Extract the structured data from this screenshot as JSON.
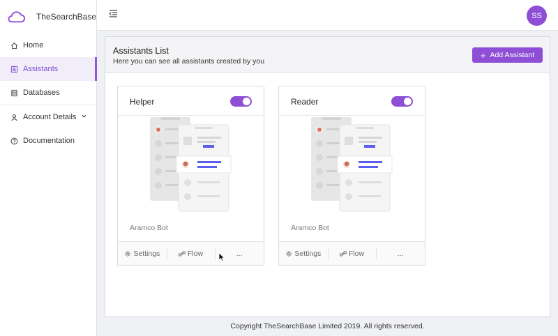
{
  "brand": {
    "name": "TheSearchBase",
    "icon": "cloud-icon"
  },
  "sidebar": {
    "items": [
      {
        "label": "Home",
        "icon": "home-icon"
      },
      {
        "label": "Assistants",
        "icon": "assistant-icon",
        "active": true
      },
      {
        "label": "Databases",
        "icon": "database-icon"
      },
      {
        "label": "Account Details",
        "icon": "user-icon"
      },
      {
        "label": "Documentation",
        "icon": "help-circle-icon"
      }
    ]
  },
  "topbar": {
    "avatar_initials": "SS"
  },
  "panel": {
    "title": "Assistants List",
    "subtitle": "Here you can see all assistants created by you",
    "add_button": "Add Assistant"
  },
  "cards": [
    {
      "title": "Helper",
      "enabled": true,
      "description": "Aramco Bot",
      "settings": "Settings",
      "flow": "Flow",
      "more": "..."
    },
    {
      "title": "Reader",
      "enabled": true,
      "description": "Aramco Bot",
      "settings": "Settings",
      "flow": "Flow",
      "more": "..."
    }
  ],
  "colors": {
    "accent": "#8e4fd6",
    "illustration_bar": "#5b5ef0"
  },
  "footer": {
    "copyright": "Copyright TheSearchBase Limited 2019. All rights reserved."
  }
}
